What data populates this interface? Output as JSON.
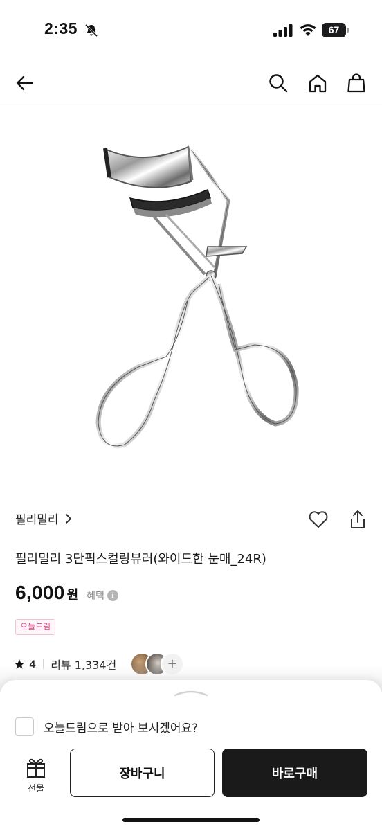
{
  "status_bar": {
    "time": "2:35",
    "battery": "67"
  },
  "nav": {
    "icons": [
      "back-arrow-icon",
      "search-icon",
      "home-icon",
      "shopping-bag-icon"
    ]
  },
  "product": {
    "brand": "필리밀리",
    "title": "필리밀리 3단픽스컬링뷰러(와이드한 눈매_24R)",
    "price": "6,000",
    "price_unit": "원",
    "benefit_label": "혜택",
    "badge": "오늘드림",
    "rating": "4",
    "review_label": "리뷰 1,334건",
    "more_reviews": "+"
  },
  "bottom_sheet": {
    "today_delivery_question": "오늘드림으로 받아 보시겠어요?",
    "gift_label": "선물",
    "cart_label": "장바구니",
    "buy_label": "바로구매"
  },
  "colors": {
    "accent_pink": "#e04484",
    "dark_button": "#1a1a1a"
  }
}
